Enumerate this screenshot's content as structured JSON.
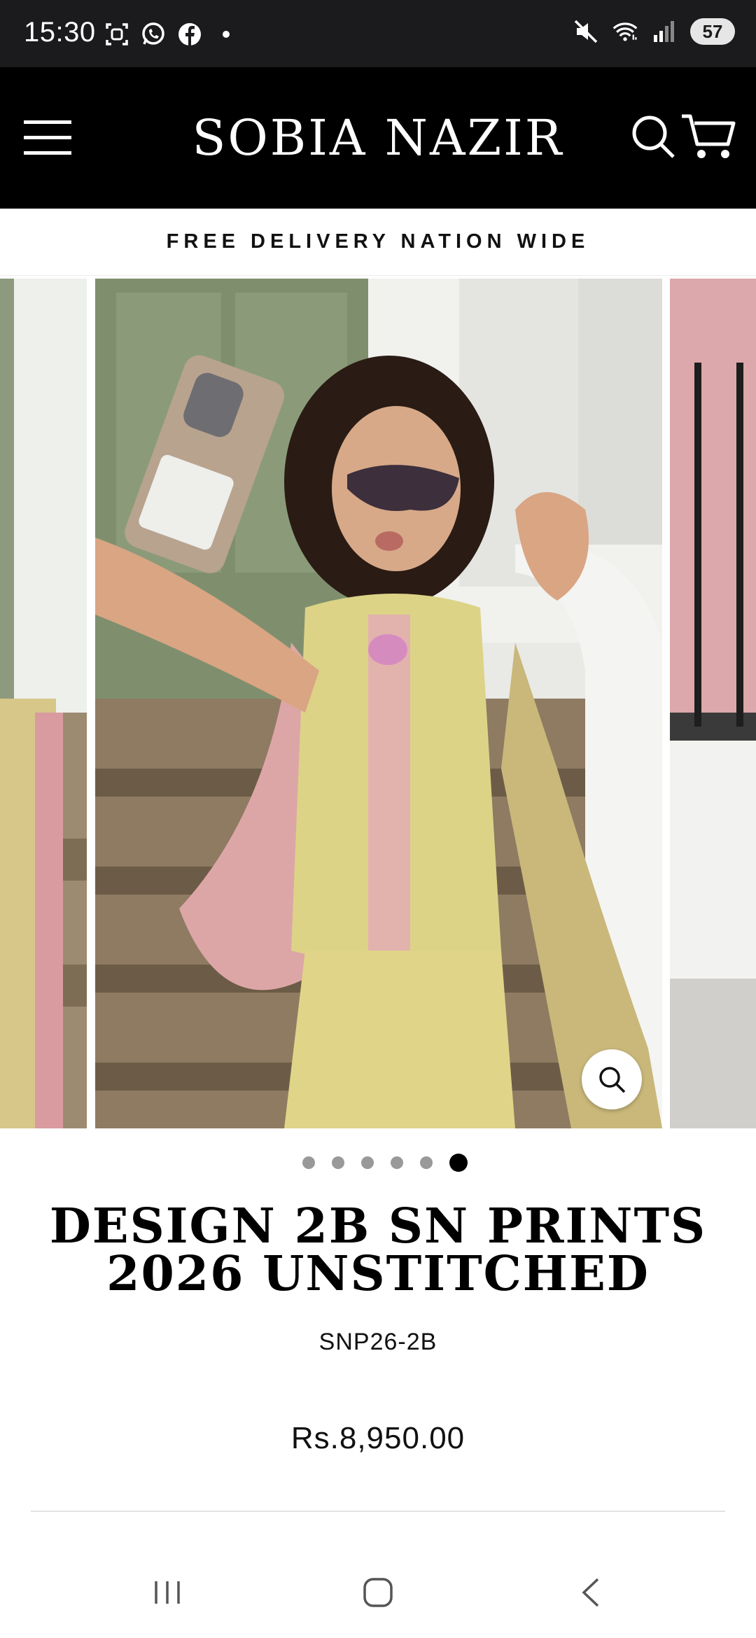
{
  "status_bar": {
    "time": "15:30",
    "battery": "57",
    "icons_left": [
      "screenshot-icon",
      "whatsapp-icon",
      "facebook-icon",
      "dot-icon"
    ],
    "icons_right": [
      "mute-icon",
      "wifi-icon",
      "signal-icon",
      "battery-icon"
    ]
  },
  "header": {
    "brand": "SOBIA NAZIR",
    "background": "#000000",
    "text_color": "#ffffff"
  },
  "announcement": {
    "text": "FREE DELIVERY NATION WIDE"
  },
  "gallery": {
    "slide_count": 6,
    "active_index": 5
  },
  "product": {
    "title": "DESIGN 2B SN PRINTS 2026 UNSTITCHED",
    "sku": "SNP26-2B",
    "price": "Rs.8,950.00"
  },
  "nav": {
    "buttons": [
      "recents-icon",
      "home-icon",
      "back-icon"
    ]
  }
}
